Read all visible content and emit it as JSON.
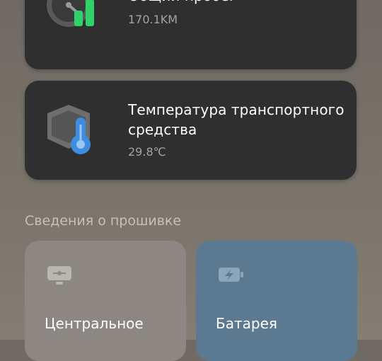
{
  "cards": [
    {
      "icon": "speedometer-chart-icon",
      "title": "Общий пробег",
      "value": "170.1KM"
    },
    {
      "icon": "vehicle-temperature-icon",
      "title": "Температура транспортного средства",
      "value": "29.8℃"
    }
  ],
  "firmware": {
    "header": "Сведения о прошивке",
    "tiles": [
      {
        "icon": "controller-icon",
        "label": "Центральное"
      },
      {
        "icon": "battery-charge-icon",
        "label": "Батарея"
      }
    ]
  },
  "colors": {
    "card_bg": "#2f2f2f",
    "accent_green": "#2fd268",
    "accent_blue": "#3d8ee0",
    "tile_gray": "#8c8782",
    "tile_blue": "#5b7a91"
  }
}
